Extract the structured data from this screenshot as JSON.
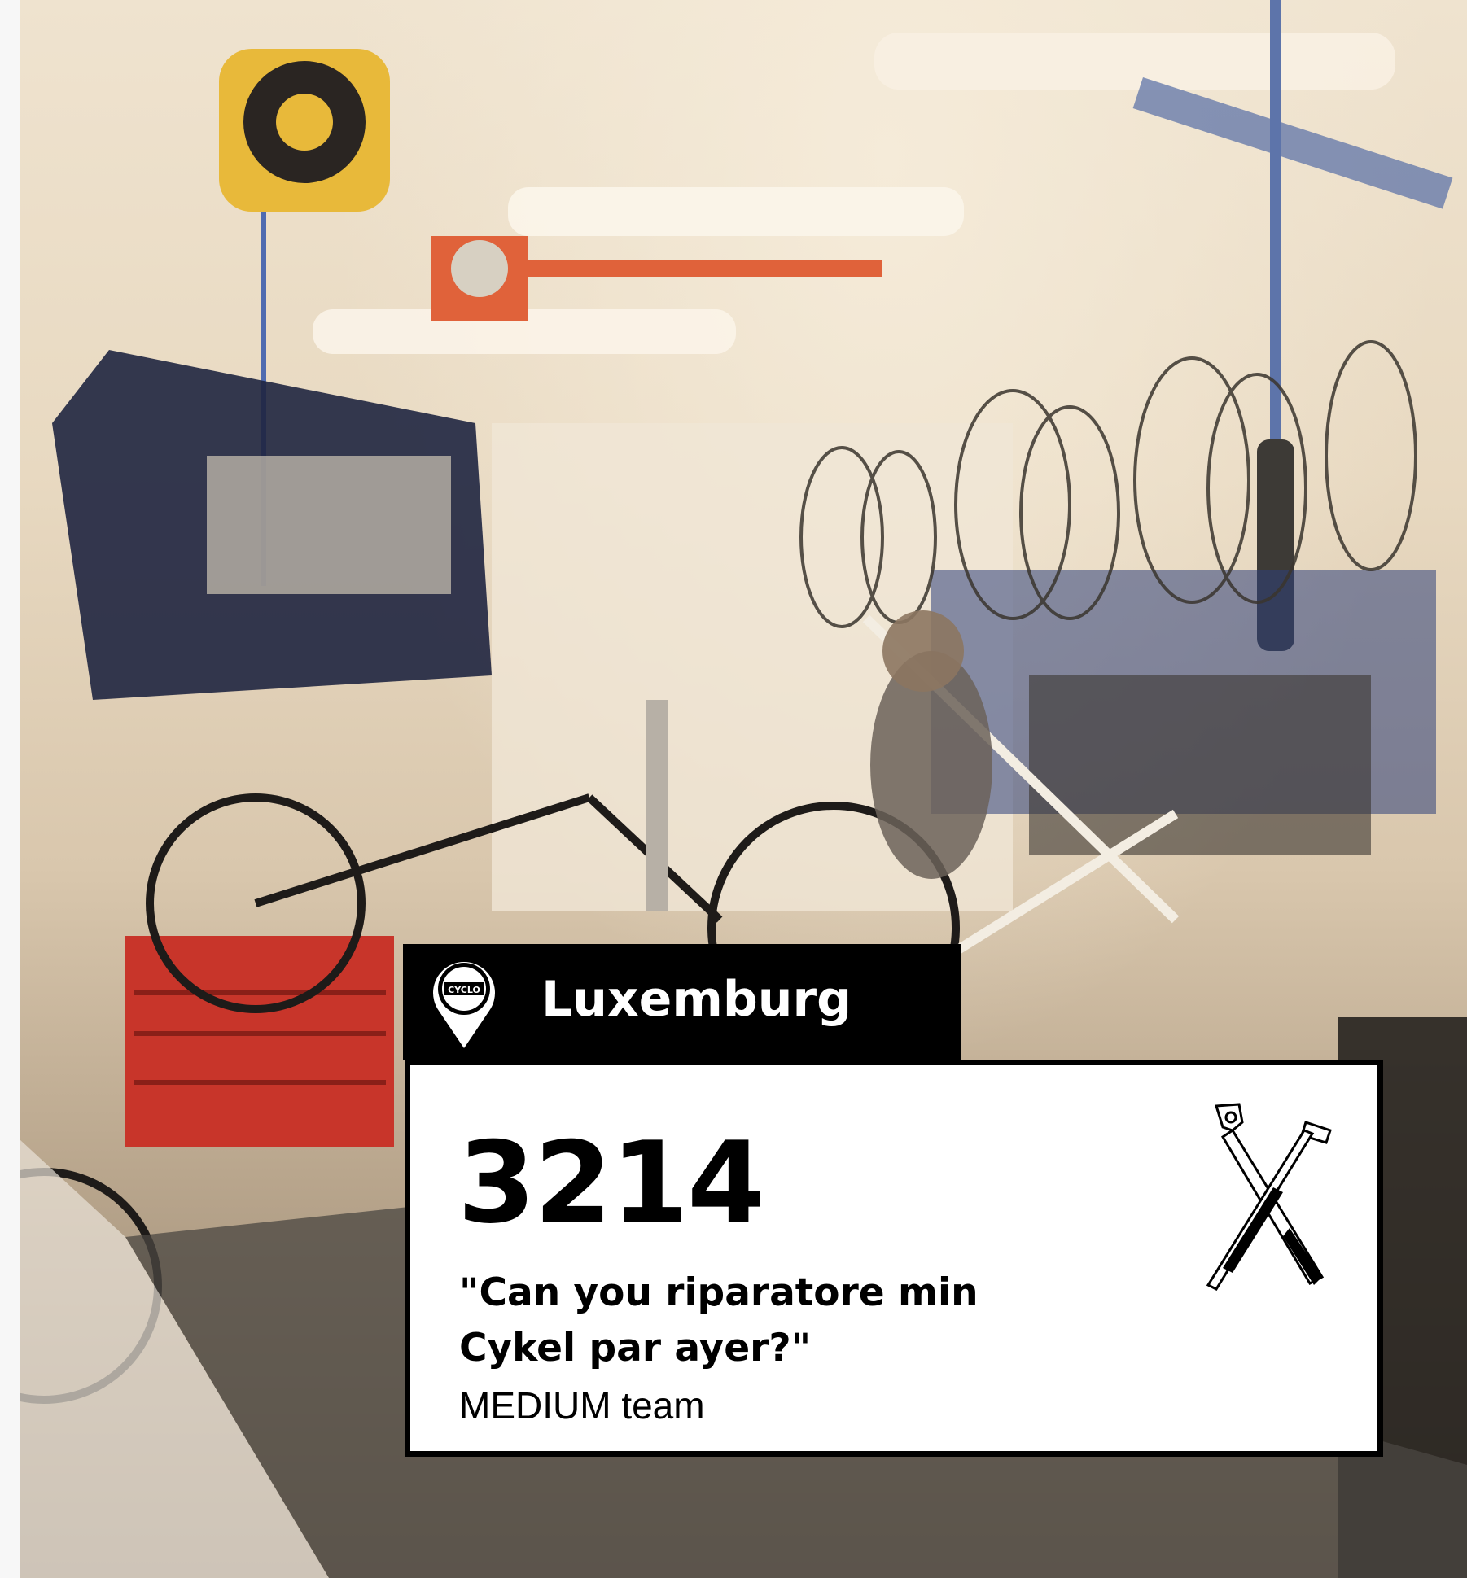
{
  "location": {
    "city": "Luxemburg",
    "pin_logo_text": "CYCLO",
    "pin_icon": "map-pin-icon"
  },
  "card": {
    "number": "3214",
    "quote_line_1": "\"Can you riparatore min",
    "quote_line_2": "Cykel par ayer?\"",
    "team": "MEDIUM team",
    "tools_icon": "crossed-wrench-tools-icon"
  },
  "colors": {
    "label_background": "#000000",
    "label_text": "#ffffff",
    "card_background": "#ffffff",
    "card_text": "#000000",
    "hose_reel_yellow": "#e8b93a",
    "toolbox_red": "#c8352a",
    "beam_orange": "#e0623a"
  }
}
